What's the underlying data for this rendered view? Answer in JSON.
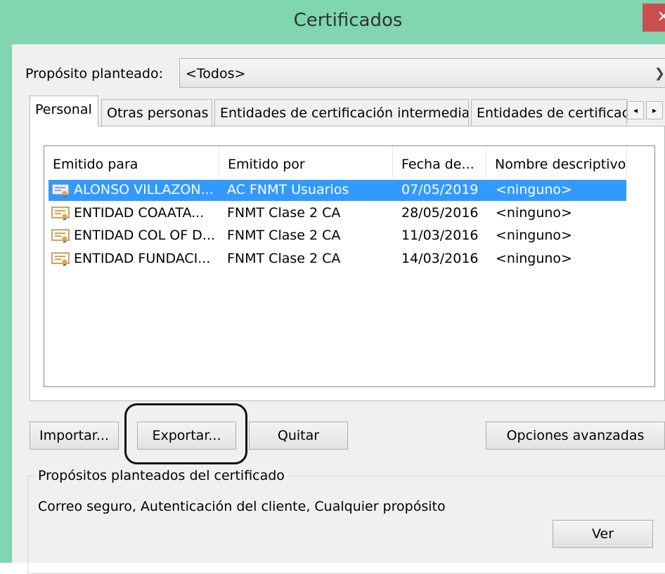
{
  "window": {
    "title": "Certificados",
    "close_glyph": "✕"
  },
  "purpose": {
    "label": "Propósito planteado:",
    "value": "<Todos>",
    "arrow_icon": "chevron-down-icon"
  },
  "tabs": [
    {
      "label": "Personal",
      "active": true
    },
    {
      "label": "Otras personas",
      "active": false
    },
    {
      "label": "Entidades de certificación intermedias",
      "active": false
    },
    {
      "label": "Entidades de certificaci",
      "active": false
    }
  ],
  "tab_scroll": {
    "left": "◂",
    "right": "▸"
  },
  "table": {
    "columns": [
      "Emitido para",
      "Emitido por",
      "Fecha de...",
      "Nombre descriptivo"
    ],
    "rows": [
      {
        "issued_to": "ALONSO VILLAZON...",
        "issued_by": "AC FNMT Usuarios",
        "date": "07/05/2019",
        "friendly_name": "<ninguno>",
        "selected": true
      },
      {
        "issued_to": "ENTIDAD COAATA...",
        "issued_by": "FNMT Clase 2 CA",
        "date": "28/05/2016",
        "friendly_name": "<ninguno>",
        "selected": false
      },
      {
        "issued_to": "ENTIDAD COL OF D...",
        "issued_by": "FNMT Clase 2 CA",
        "date": "11/03/2016",
        "friendly_name": "<ninguno>",
        "selected": false
      },
      {
        "issued_to": "ENTIDAD FUNDACI...",
        "issued_by": "FNMT Clase 2 CA",
        "date": "14/03/2016",
        "friendly_name": "<ninguno>",
        "selected": false
      }
    ]
  },
  "buttons": {
    "import": "Importar...",
    "export": "Exportar...",
    "remove": "Quitar",
    "advanced": "Opciones avanzadas",
    "view": "Ver"
  },
  "purposes_group": {
    "title": "Propósitos planteados del certificado",
    "text": "Correo seguro, Autenticación del cliente, Cualquier propósito"
  },
  "colors": {
    "title_bar": "#7fd6b1",
    "selection": "#3399ff",
    "close": "#c94f4f"
  }
}
